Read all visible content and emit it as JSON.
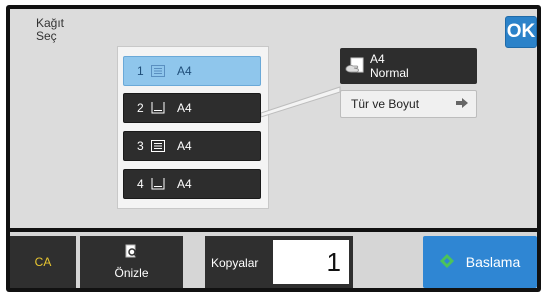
{
  "header": {
    "title_line1": "Kağıt",
    "title_line2": "Seç",
    "ok_label": "OK"
  },
  "trays": [
    {
      "number": "1",
      "size": "A4",
      "icon": "tray-lines-icon",
      "selected": true
    },
    {
      "number": "2",
      "size": "A4",
      "icon": "tray-bracket-icon",
      "selected": false
    },
    {
      "number": "3",
      "size": "A4",
      "icon": "tray-lines-icon",
      "selected": false
    },
    {
      "number": "4",
      "size": "A4",
      "icon": "tray-bracket-icon",
      "selected": false
    }
  ],
  "paper_info": {
    "size": "A4",
    "type": "Normal",
    "icon": "paper-hand-icon"
  },
  "type_size_button": {
    "label": "Tür ve Boyut",
    "icon": "arrow-right-icon"
  },
  "footer": {
    "ca_label": "CA",
    "preview_label": "Önizle",
    "copies_label": "Kopyalar",
    "copies_value": "1",
    "start_label": "Baslama"
  },
  "colors": {
    "selected_tray": "#8fc6ec",
    "start_button": "#2f86d3",
    "ca_text": "#e8c630",
    "ok_button": "#2b82c9"
  }
}
